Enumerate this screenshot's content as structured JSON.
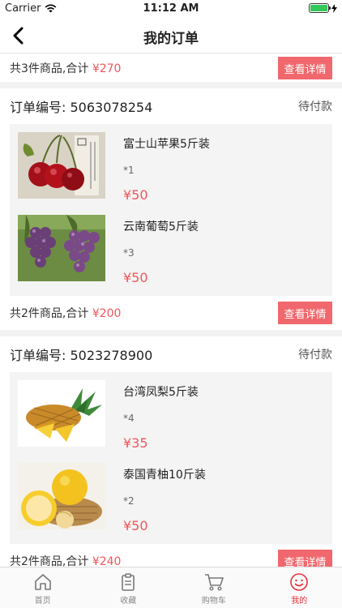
{
  "status_bar": {
    "carrier": "Carrier",
    "time": "11:12 AM"
  },
  "nav": {
    "title": "我的订单"
  },
  "previous_order": {
    "summary_prefix": "共3件商品,合计",
    "total": "¥270",
    "detail_label": "查看详情"
  },
  "orders": [
    {
      "number": "订单编号: 5063078254",
      "status": "待付款",
      "items": [
        {
          "name": "富士山苹果5斤装",
          "qty": "*1",
          "price": "¥50",
          "image": "cherries"
        },
        {
          "name": "云南葡萄5斤装",
          "qty": "*3",
          "price": "¥50",
          "image": "grapes"
        }
      ],
      "summary_prefix": "共2件商品,合计",
      "total": "¥200",
      "detail_label": "查看详情"
    },
    {
      "number": "订单编号: 5023278900",
      "status": "待付款",
      "items": [
        {
          "name": "台湾凤梨5斤装",
          "qty": "*4",
          "price": "¥35",
          "image": "pineapple"
        },
        {
          "name": "泰国青柚10斤装",
          "qty": "*2",
          "price": "¥50",
          "image": "pomelo"
        }
      ],
      "summary_prefix": "共2件商品,合计",
      "total": "¥240",
      "detail_label": "查看详情"
    }
  ],
  "tabbar": [
    {
      "label": "首页",
      "icon": "home-icon",
      "active": false
    },
    {
      "label": "收藏",
      "icon": "clipboard-icon",
      "active": false
    },
    {
      "label": "购物车",
      "icon": "cart-icon",
      "active": false
    },
    {
      "label": "我的",
      "icon": "smiley-icon",
      "active": true
    }
  ],
  "colors": {
    "accent": "#f0565c",
    "button": "#f0686d",
    "active_tab": "#e8333c"
  }
}
